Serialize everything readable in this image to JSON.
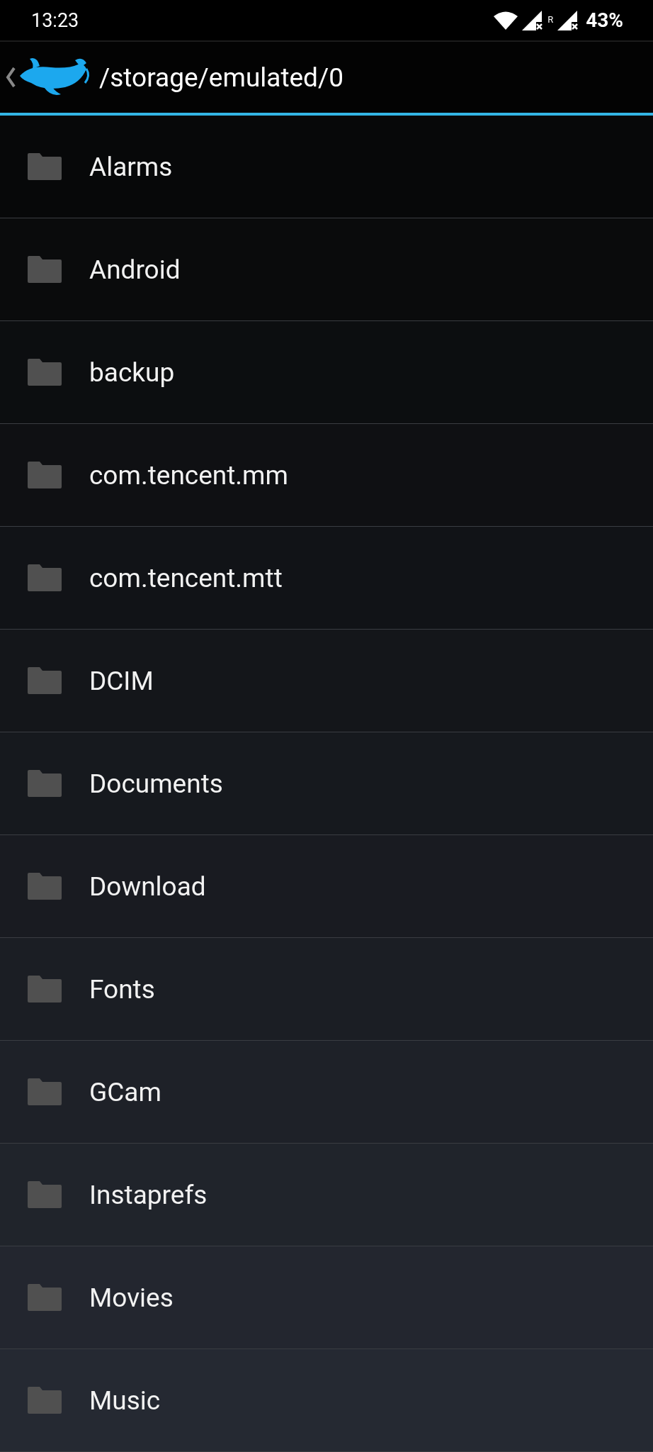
{
  "status_bar": {
    "time": "13:23",
    "roaming": "R",
    "battery": "43%"
  },
  "header": {
    "path": "/storage/emulated/0"
  },
  "folders": [
    {
      "name": "Alarms"
    },
    {
      "name": "Android"
    },
    {
      "name": "backup"
    },
    {
      "name": "com.tencent.mm"
    },
    {
      "name": "com.tencent.mtt"
    },
    {
      "name": "DCIM"
    },
    {
      "name": "Documents"
    },
    {
      "name": "Download"
    },
    {
      "name": "Fonts"
    },
    {
      "name": "GCam"
    },
    {
      "name": "Instaprefs"
    },
    {
      "name": "Movies"
    },
    {
      "name": "Music"
    }
  ]
}
